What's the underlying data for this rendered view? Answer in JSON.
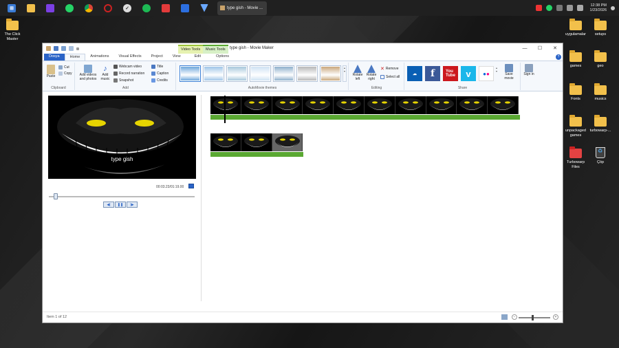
{
  "taskbar": {
    "task_label": "type gish - Movie ...",
    "apps": [
      "windows-icon",
      "file-explorer-icon",
      "media-app-icon",
      "whatsapp-icon",
      "chrome-icon",
      "record-app-icon",
      "clock-app-icon",
      "spotify-icon",
      "cdr-app-icon",
      "blue-app-icon",
      "vpn-app-icon"
    ],
    "clock_time": "12:38 PM",
    "clock_date": "1/23/2026"
  },
  "desktop": {
    "left_icons": [
      {
        "label": "The Click Master"
      }
    ],
    "right_icons": [
      {
        "label": "uygulamalar"
      },
      {
        "label": "setups"
      },
      {
        "label": "games"
      },
      {
        "label": "geo"
      },
      {
        "label": "Fonts"
      },
      {
        "label": "musics"
      },
      {
        "label": "unpackaged games"
      },
      {
        "label": "turbowarp-..."
      },
      {
        "label": "Turbowarp Files"
      },
      {
        "label": "Çöp"
      }
    ]
  },
  "window": {
    "title": "type gish - Movie Maker",
    "ctx_video": "Video Tools",
    "ctx_music": "Music Tools",
    "tabs": [
      "Dosya",
      "Home",
      "Animations",
      "Visual Effects",
      "Project",
      "View",
      "Edit",
      "Options"
    ],
    "help": "?"
  },
  "ribbon": {
    "clipboard": {
      "label": "Clipboard",
      "paste": "Paste",
      "cut": "Cut",
      "copy": "Copy"
    },
    "add": {
      "label": "Add",
      "add_videos": "Add videos and photos",
      "add_music": "Add music",
      "webcam": "Webcam video",
      "narration": "Record narration",
      "snapshot": "Snapshot",
      "title": "Title",
      "caption": "Caption",
      "credits": "Credits"
    },
    "themes": {
      "label": "AutoMovie themes",
      "colors": [
        "#6fa8dc",
        "#9fc5e8",
        "#a7c7dc",
        "#cfe2f3",
        "#8eb0cc",
        "#b7b7b7",
        "#c9a77c"
      ]
    },
    "editing": {
      "label": "Editing",
      "rotate_left": "Rotate left",
      "rotate_right": "Rotate right",
      "remove": "Remove",
      "select_all": "Select all"
    },
    "share": {
      "label": "Share",
      "save_movie": "Save movie",
      "sign_in": "Sign in",
      "services": [
        {
          "name": "onedrive-icon",
          "color": "#0a5fb4",
          "glyph": "☁"
        },
        {
          "name": "facebook-icon",
          "color": "#3b5998",
          "glyph": "f"
        },
        {
          "name": "youtube-icon",
          "color": "#cc181e",
          "glyph": "▶"
        },
        {
          "name": "vimeo-icon",
          "color": "#1ab7ea",
          "glyph": "v"
        },
        {
          "name": "flickr-icon",
          "color": "#ffffff",
          "glyph": "●●"
        }
      ]
    }
  },
  "preview": {
    "caption": "type gish",
    "timecode": "00:03.23/01:19.00",
    "progress": 0.04
  },
  "storyboard": {
    "clip1_frames": 10,
    "clip2_frames": 3
  },
  "status": {
    "item": "Item 1 of 12"
  }
}
